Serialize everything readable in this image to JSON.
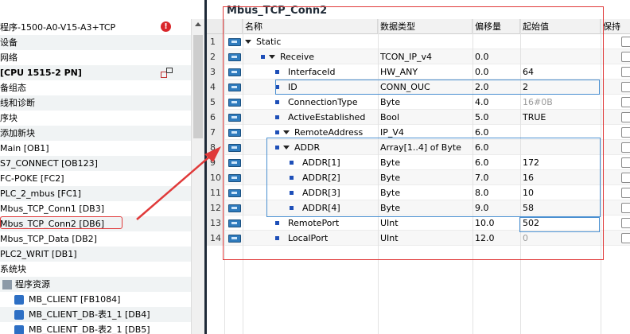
{
  "tree": {
    "items": [
      {
        "label": "程序-1500-A0-V15-A3+TCP",
        "indent": 0
      },
      {
        "label": "设备",
        "indent": 0
      },
      {
        "label": "网络",
        "indent": 0
      },
      {
        "label": "[CPU 1515-2 PN]",
        "indent": 0
      },
      {
        "label": "备组态",
        "indent": 0
      },
      {
        "label": "线和诊断",
        "indent": 0
      },
      {
        "label": "序块",
        "indent": 0
      },
      {
        "label": "添加新块",
        "indent": 0
      },
      {
        "label": "Main [OB1]",
        "indent": 0
      },
      {
        "label": "S7_CONNECT [OB123]",
        "indent": 0
      },
      {
        "label": "FC-POKE [FC2]",
        "indent": 0
      },
      {
        "label": "PLC_2_mbus [FC1]",
        "indent": 0
      },
      {
        "label": "Mbus_TCP_Conn1 [DB3]",
        "indent": 0
      },
      {
        "label": "Mbus_TCP_Conn2 [DB6]",
        "indent": 0
      },
      {
        "label": "Mbus_TCP_Data [DB2]",
        "indent": 0
      },
      {
        "label": "PLC2_WRIT [DB1]",
        "indent": 0
      },
      {
        "label": "系统块",
        "indent": 0
      },
      {
        "label": "程序资源",
        "indent": 1
      },
      {
        "label": "MB_CLIENT [FB1084]",
        "indent": 2
      },
      {
        "label": "MB_CLIENT_DB-表1_1 [DB4]",
        "indent": 2
      },
      {
        "label": "MB_CLIENT_DB-表2_1 [DB5]",
        "indent": 2
      }
    ]
  },
  "editor": {
    "title": "Mbus_TCP_Conn2",
    "columns": [
      "名称",
      "数据类型",
      "偏移量",
      "起始值",
      "保持"
    ],
    "rows": [
      {
        "n": "1",
        "level": 0,
        "expand": true,
        "bullet": false,
        "name": "Static",
        "type": "",
        "offset": "",
        "start": "",
        "start_gray": false
      },
      {
        "n": "2",
        "level": 1,
        "expand": true,
        "bullet": true,
        "name": "Receive",
        "type": "TCON_IP_v4",
        "offset": "0.0",
        "start": "",
        "start_gray": false
      },
      {
        "n": "3",
        "level": 2,
        "expand": false,
        "bullet": true,
        "name": "InterfaceId",
        "type": "HW_ANY",
        "offset": "0.0",
        "start": "64",
        "start_gray": false
      },
      {
        "n": "4",
        "level": 2,
        "expand": false,
        "bullet": true,
        "name": "ID",
        "type": "CONN_OUC",
        "offset": "2.0",
        "start": "2",
        "start_gray": false
      },
      {
        "n": "5",
        "level": 2,
        "expand": false,
        "bullet": true,
        "name": "ConnectionType",
        "type": "Byte",
        "offset": "4.0",
        "start": "16#0B",
        "start_gray": true
      },
      {
        "n": "6",
        "level": 2,
        "expand": false,
        "bullet": true,
        "name": "ActiveEstablished",
        "type": "Bool",
        "offset": "5.0",
        "start": "TRUE",
        "start_gray": false
      },
      {
        "n": "7",
        "level": 2,
        "expand": true,
        "bullet": true,
        "name": "RemoteAddress",
        "type": "IP_V4",
        "offset": "6.0",
        "start": "",
        "start_gray": false
      },
      {
        "n": "8",
        "level": 3,
        "expand": true,
        "bullet": true,
        "name": "ADDR",
        "type": "Array[1..4] of Byte",
        "offset": "6.0",
        "start": "",
        "start_gray": false
      },
      {
        "n": "9",
        "level": 4,
        "expand": false,
        "bullet": true,
        "name": "ADDR[1]",
        "type": "Byte",
        "offset": "6.0",
        "start": "172",
        "start_gray": false
      },
      {
        "n": "10",
        "level": 4,
        "expand": false,
        "bullet": true,
        "name": "ADDR[2]",
        "type": "Byte",
        "offset": "7.0",
        "start": "16",
        "start_gray": false
      },
      {
        "n": "11",
        "level": 4,
        "expand": false,
        "bullet": true,
        "name": "ADDR[3]",
        "type": "Byte",
        "offset": "8.0",
        "start": "10",
        "start_gray": false
      },
      {
        "n": "12",
        "level": 4,
        "expand": false,
        "bullet": true,
        "name": "ADDR[4]",
        "type": "Byte",
        "offset": "9.0",
        "start": "58",
        "start_gray": false
      },
      {
        "n": "13",
        "level": 2,
        "expand": false,
        "bullet": true,
        "name": "RemotePort",
        "type": "UInt",
        "offset": "10.0",
        "start": "502",
        "start_gray": false
      },
      {
        "n": "14",
        "level": 2,
        "expand": false,
        "bullet": true,
        "name": "LocalPort",
        "type": "UInt",
        "offset": "12.0",
        "start": "0",
        "start_gray": true
      }
    ]
  },
  "colors": {
    "accent_red": "#e03a3a",
    "accent_blue": "#4a8fd0",
    "divider": "#1e2a38"
  }
}
